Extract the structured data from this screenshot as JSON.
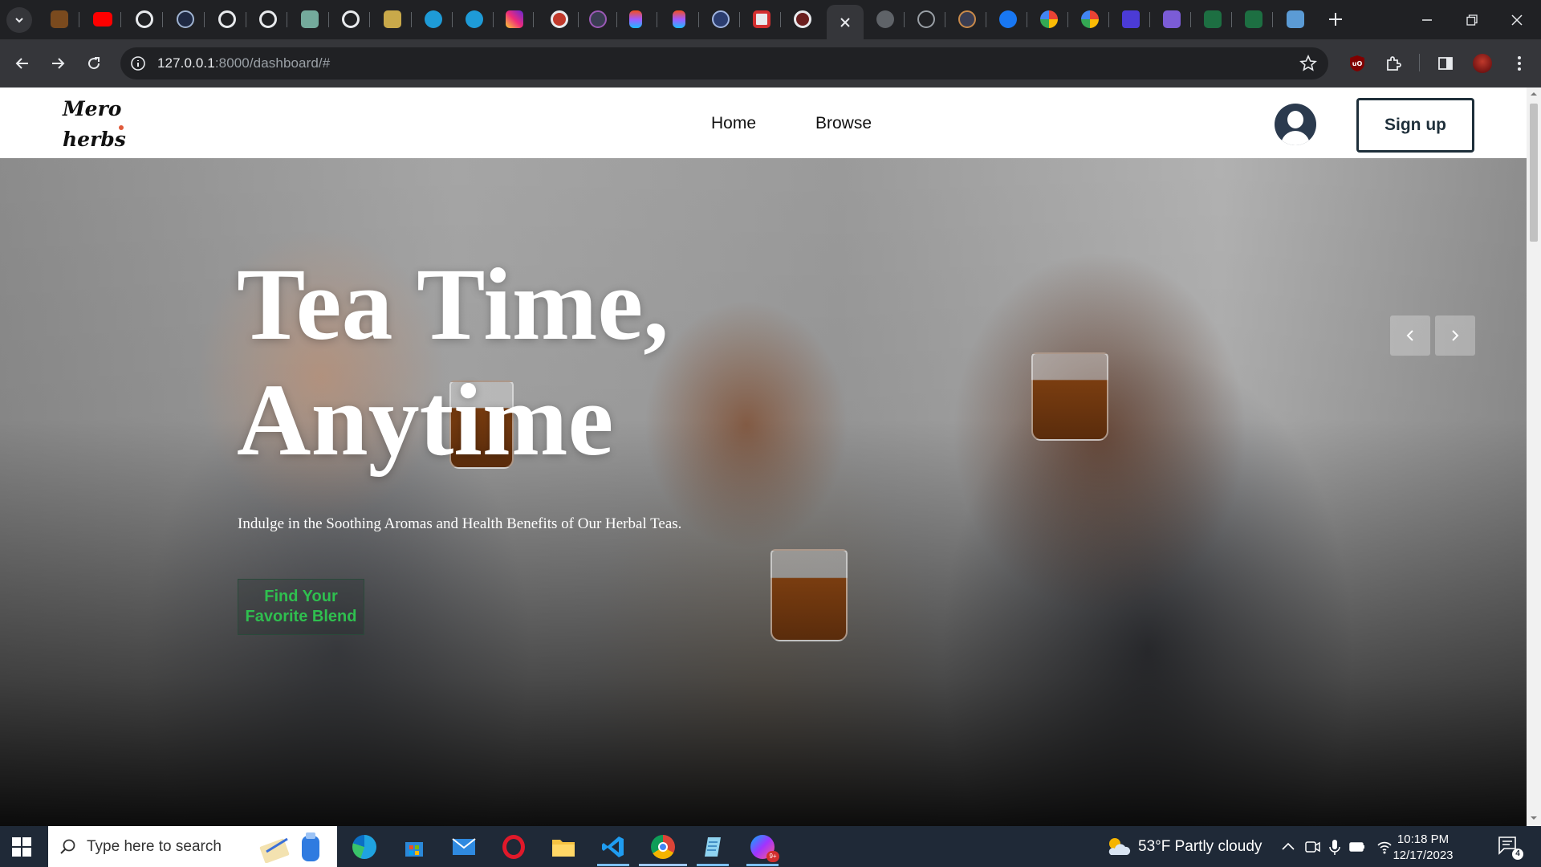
{
  "browser": {
    "url_host": "127.0.0.1",
    "url_rest": ":8000/dashboard/#",
    "colors": {
      "frame": "#202124",
      "toolbar": "#35363a"
    },
    "tab_icons": [
      "brown-app-icon",
      "youtube-icon",
      "openai-icon",
      "dark-circle-icon",
      "openai-icon",
      "openai-icon",
      "openai-green-icon",
      "openai-icon",
      "gold-app-icon",
      "canva-icon",
      "canva-icon",
      "instagram-icon",
      "record-icon",
      "dark-app-icon",
      "figma-icon",
      "figma-icon",
      "e-icon",
      "red-square-icon",
      "openai-icon",
      "close-tab-icon",
      "globe-icon",
      "m-icon",
      "dark-app-icon",
      "facebook-icon",
      "google-icon",
      "google-icon",
      "blue-app-icon",
      "purple-app-icon",
      "excel-icon",
      "excel-icon",
      "blue-book-icon"
    ]
  },
  "site": {
    "logo_line1": "Mero",
    "logo_line2": "herbs",
    "nav": {
      "home": "Home",
      "browse": "Browse"
    },
    "signup_label": "Sign up",
    "colors": {
      "accent_green": "#2fbf4f",
      "signup_border": "#1e2f3a"
    }
  },
  "hero": {
    "title_line1": "Tea Time,",
    "title_line2": "Anytime",
    "subtitle": "Indulge in the Soothing Aromas and Health Benefits of Our Herbal Teas.",
    "cta_line1": "Find Your",
    "cta_line2": "Favorite Blend"
  },
  "taskbar": {
    "search_placeholder": "Type here to search",
    "weather": "53°F  Partly cloudy",
    "time": "10:18 PM",
    "date": "12/17/2023",
    "notification_count": "4",
    "apps": [
      "edge-icon",
      "store-icon",
      "mail-icon",
      "opera-icon",
      "file-explorer-icon",
      "vscode-icon",
      "chrome-icon",
      "notepad-icon",
      "messenger-icon"
    ]
  }
}
